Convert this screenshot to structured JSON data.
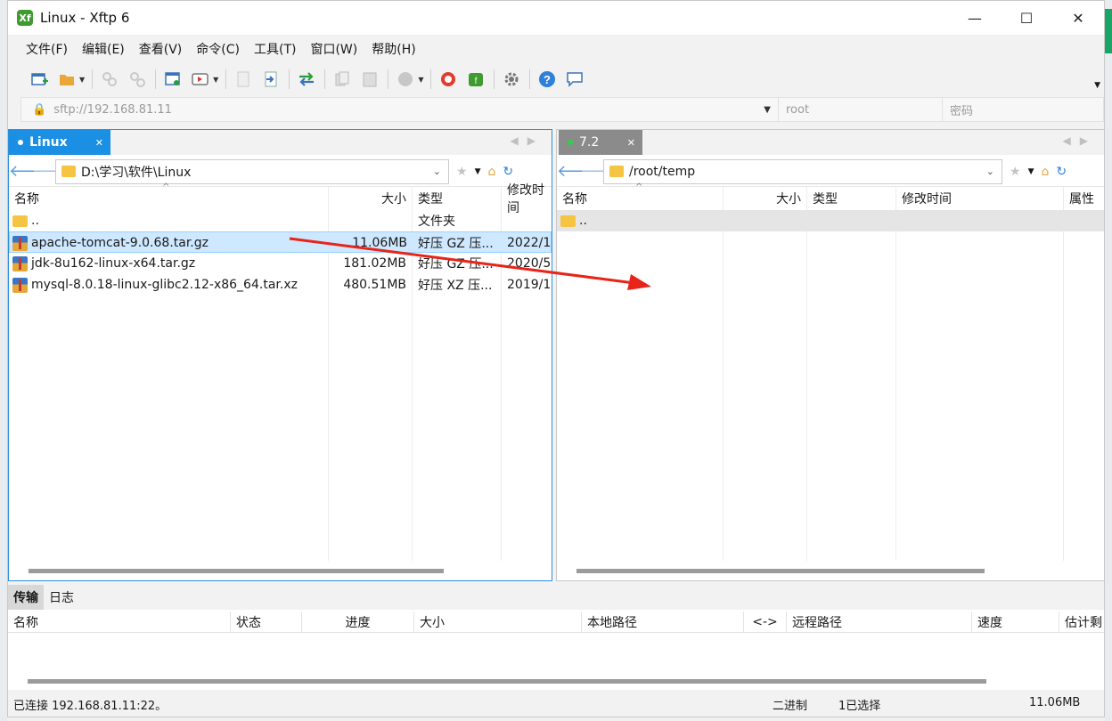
{
  "window": {
    "title": "Linux - Xftp 6",
    "app_logo_text": "Xf"
  },
  "menu": [
    "文件(F)",
    "编辑(E)",
    "查看(V)",
    "命令(C)",
    "工具(T)",
    "窗口(W)",
    "帮助(H)"
  ],
  "toolbar_icons": [
    "new-session-icon",
    "open-folder-icon",
    "disconnect-icon",
    "reconnect-icon",
    "properties-icon",
    "log-icon",
    "copy-file-icon",
    "transfer-file-icon",
    "sync-icon",
    "copy-icon",
    "paste-icon",
    "globe-icon",
    "xshell-icon",
    "xftp-icon",
    "settings-icon",
    "help-icon",
    "chat-icon"
  ],
  "address": {
    "url": "sftp://192.168.81.11",
    "user_placeholder": "root",
    "password_placeholder": "密码"
  },
  "left_pane": {
    "tab_label": "Linux",
    "path": "D:\\学习\\软件\\Linux",
    "columns": {
      "name": "名称",
      "size": "大小",
      "type": "类型",
      "modified": "修改时间"
    },
    "rows": [
      {
        "icon": "folder-icon",
        "name": "..",
        "size": "",
        "type": "文件夹",
        "modified": ""
      },
      {
        "icon": "archive-icon",
        "name": "apache-tomcat-9.0.68.tar.gz",
        "size": "11.06MB",
        "type": "好压 GZ 压...",
        "modified": "2022/1",
        "selected": true
      },
      {
        "icon": "archive-icon",
        "name": "jdk-8u162-linux-x64.tar.gz",
        "size": "181.02MB",
        "type": "好压 GZ 压...",
        "modified": "2020/5"
      },
      {
        "icon": "archive-icon",
        "name": "mysql-8.0.18-linux-glibc2.12-x86_64.tar.xz",
        "size": "480.51MB",
        "type": "好压 XZ 压...",
        "modified": "2019/1"
      }
    ]
  },
  "right_pane": {
    "tab_label": "7.2",
    "path": "/root/temp",
    "columns": {
      "name": "名称",
      "size": "大小",
      "type": "类型",
      "modified": "修改时间",
      "attr": "属性"
    },
    "rows": [
      {
        "icon": "folder-icon",
        "name": ".."
      }
    ]
  },
  "transfer": {
    "tabs": [
      "传输",
      "日志"
    ],
    "columns": [
      "名称",
      "状态",
      "进度",
      "大小",
      "本地路径",
      "<->",
      "远程路径",
      "速度",
      "估计剩"
    ]
  },
  "status": {
    "connection": "已连接 192.168.81.11:22。",
    "mode": "二进制",
    "selection": "1已选择",
    "size": "11.06MB"
  },
  "colors": {
    "accent": "#1a8fe3",
    "selection": "#cde8ff",
    "annotation_arrow": "#e8241a"
  }
}
